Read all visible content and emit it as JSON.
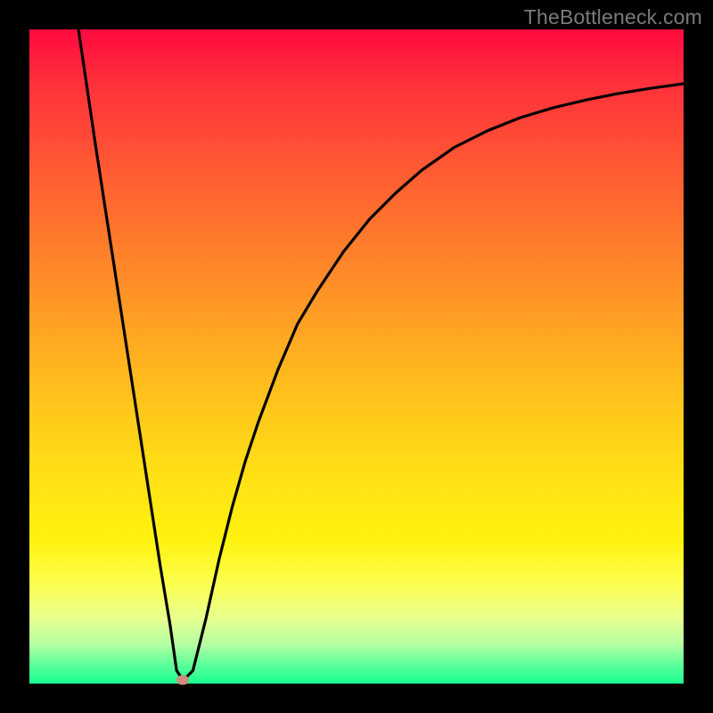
{
  "watermark": "TheBottleneck.com",
  "chart_data": {
    "type": "line",
    "title": "",
    "xlabel": "",
    "ylabel": "",
    "xlim": [
      0,
      100
    ],
    "ylim": [
      0,
      100
    ],
    "series": [
      {
        "name": "curve",
        "x": [
          7.5,
          10,
          12,
          14,
          16,
          18,
          20,
          21.5,
          22.5,
          23.5,
          25,
          27,
          29,
          31,
          33,
          35,
          38,
          41,
          44,
          48,
          52,
          56,
          60,
          65,
          70,
          75,
          80,
          85,
          90,
          95,
          100
        ],
        "y": [
          100,
          83,
          70,
          57,
          44,
          31,
          18,
          9,
          2,
          0.5,
          2,
          10,
          19,
          27,
          34,
          40,
          48,
          55,
          60,
          66,
          71,
          75,
          78.5,
          82,
          84.5,
          86.5,
          88,
          89.2,
          90.2,
          91,
          91.7
        ]
      }
    ],
    "marker": {
      "x": 23.5,
      "y": 0.5
    },
    "gradient_stops": [
      {
        "pos": 0,
        "color": "#ff0a3f"
      },
      {
        "pos": 44,
        "color": "#ff9e24"
      },
      {
        "pos": 78,
        "color": "#fff20e"
      },
      {
        "pos": 100,
        "color": "#1aff90"
      }
    ]
  }
}
